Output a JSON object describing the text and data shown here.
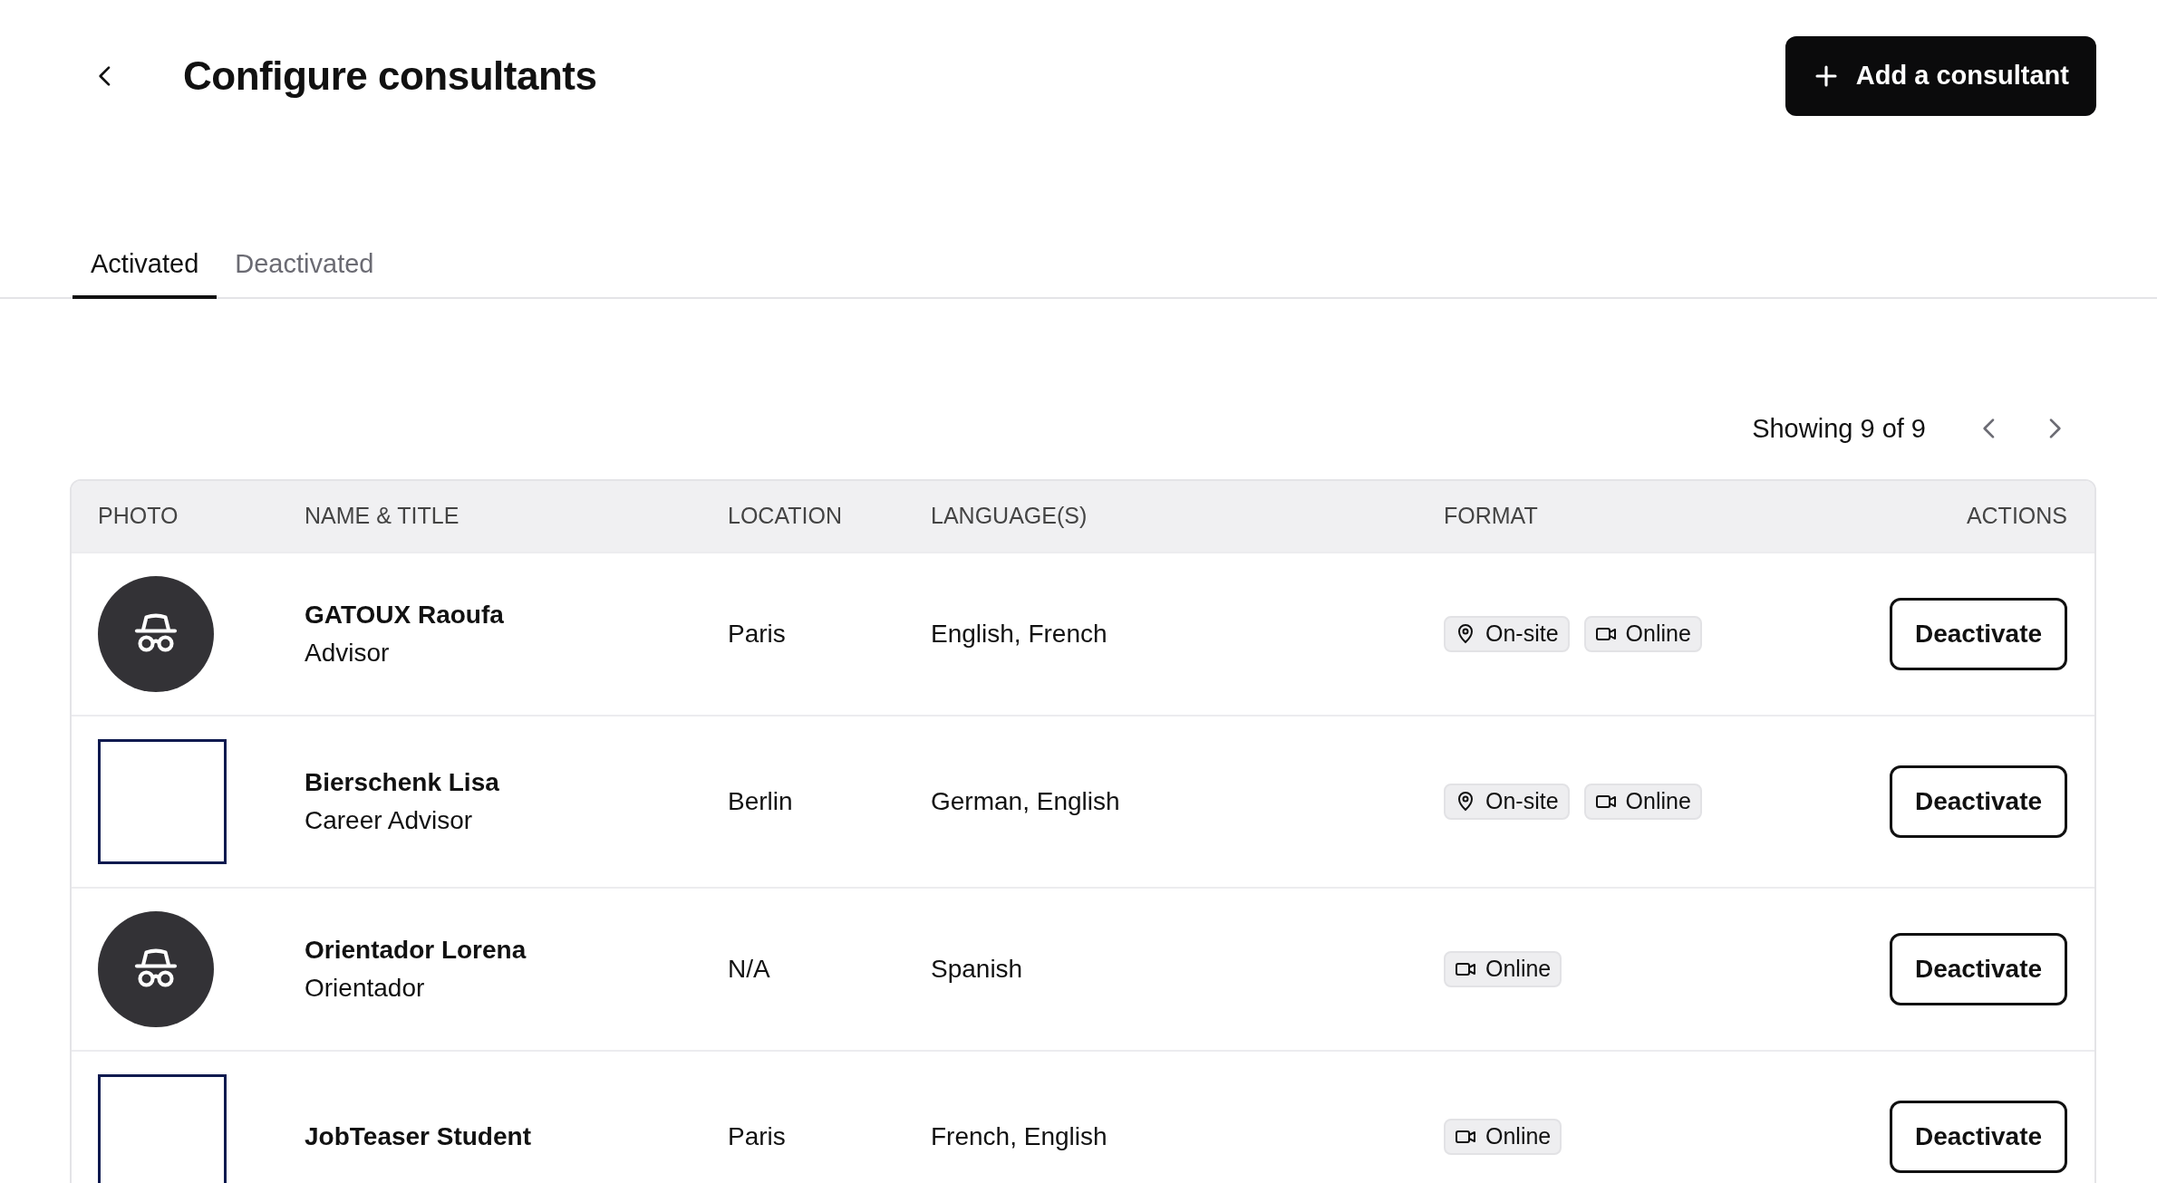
{
  "header": {
    "title": "Configure consultants",
    "add_button": "Add a consultant"
  },
  "tabs": [
    {
      "label": "Activated",
      "selected": true
    },
    {
      "label": "Deactivated",
      "selected": false
    }
  ],
  "pagination": {
    "text": "Showing 9 of 9"
  },
  "table": {
    "columns": [
      "PHOTO",
      "NAME & TITLE",
      "LOCATION",
      "LANGUAGE(S)",
      "FORMAT",
      "ACTIONS"
    ],
    "rows": [
      {
        "kind": "avatar",
        "name": "GATOUX Raoufa",
        "title": "Advisor",
        "location": "Paris",
        "languages": "English, French",
        "formats": [
          {
            "kind": "onsite",
            "label": "On-site"
          },
          {
            "kind": "online",
            "label": "Online"
          }
        ],
        "action": "Deactivate"
      },
      {
        "kind": "empty",
        "name": "Bierschenk Lisa",
        "title": "Career Advisor",
        "location": "Berlin",
        "languages": "German, English",
        "formats": [
          {
            "kind": "onsite",
            "label": "On-site"
          },
          {
            "kind": "online",
            "label": "Online"
          }
        ],
        "action": "Deactivate"
      },
      {
        "kind": "avatar",
        "name": "Orientador Lorena",
        "title": "Orientador",
        "location": "N/A",
        "languages": "Spanish",
        "formats": [
          {
            "kind": "online",
            "label": "Online"
          }
        ],
        "action": "Deactivate"
      },
      {
        "kind": "empty",
        "name": "JobTeaser Student",
        "location": "Paris",
        "languages": "French, English",
        "formats": [
          {
            "kind": "online",
            "label": "Online"
          }
        ],
        "action": "Deactivate"
      }
    ]
  }
}
